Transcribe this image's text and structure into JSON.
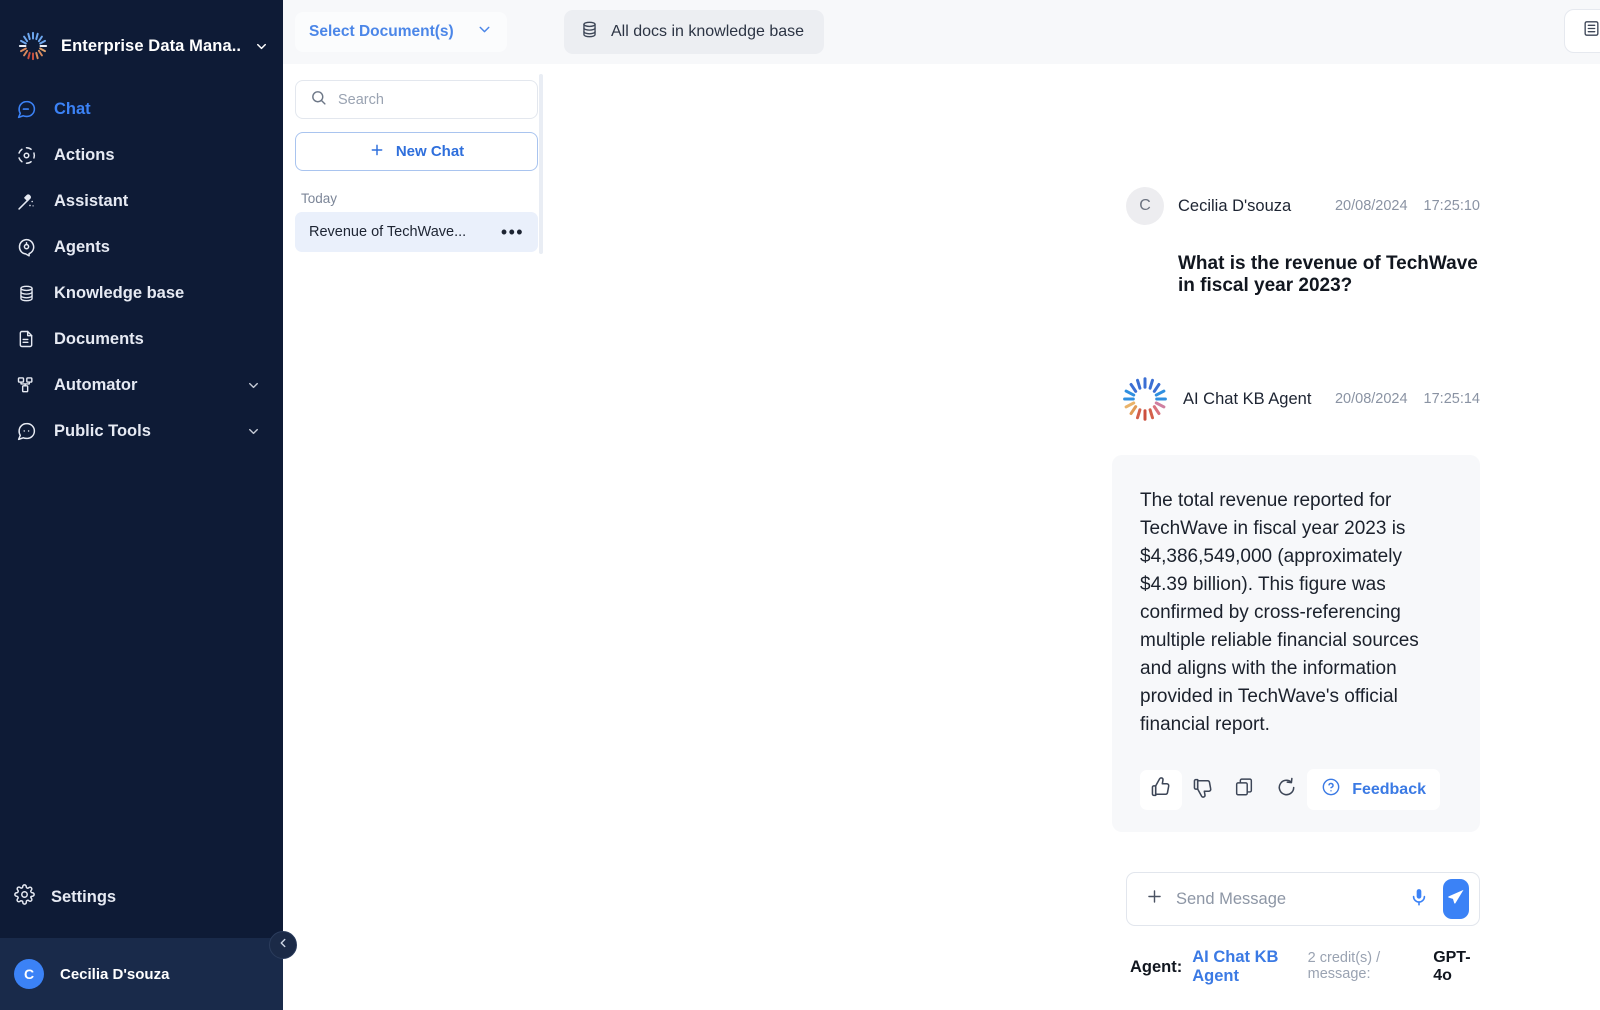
{
  "sidebar": {
    "brand": {
      "name": "Enterprise Data Mana..",
      "logo_icon": "sunburst-logo-icon",
      "caret_icon": "chevron-down-icon"
    },
    "items": [
      {
        "label": "Chat",
        "icon": "chat-bubble-icon",
        "active": true,
        "expandable": false
      },
      {
        "label": "Actions",
        "icon": "actions-gear-icon",
        "active": false,
        "expandable": false
      },
      {
        "label": "Assistant",
        "icon": "magic-wand-icon",
        "active": false,
        "expandable": false
      },
      {
        "label": "Agents",
        "icon": "agent-head-icon",
        "active": false,
        "expandable": false
      },
      {
        "label": "Knowledge base",
        "icon": "database-icon",
        "active": false,
        "expandable": false
      },
      {
        "label": "Documents",
        "icon": "document-icon",
        "active": false,
        "expandable": false
      },
      {
        "label": "Automator",
        "icon": "automator-nodes-icon",
        "active": false,
        "expandable": true
      },
      {
        "label": "Public Tools",
        "icon": "public-tools-chat-icon",
        "active": false,
        "expandable": true
      }
    ],
    "settings": {
      "label": "Settings",
      "icon": "gear-icon"
    },
    "user": {
      "name": "Cecilia D'souza",
      "initial": "C"
    },
    "collapse": {
      "icon": "chevron-left-icon"
    }
  },
  "chatlist": {
    "select_documents": {
      "label": "Select Document(s)",
      "caret_icon": "chevron-down-icon"
    },
    "search": {
      "placeholder": "Search",
      "value": "",
      "icon": "search-icon"
    },
    "new_chat": {
      "label": "New Chat",
      "icon": "plus-icon"
    },
    "group_label": "Today",
    "items": [
      {
        "title": "Revenue of TechWave...",
        "selected": true,
        "menu_icon": "ellipsis-icon"
      }
    ]
  },
  "header": {
    "knowledge_pill": {
      "label": "All docs in knowledge base",
      "icon": "database-icon"
    },
    "right_button": {
      "icon": "knowledge-list-icon"
    }
  },
  "conversation": {
    "user_message": {
      "author": "Cecilia D'souza",
      "initial": "C",
      "date": "20/08/2024",
      "time": "17:25:10",
      "text": "What is the revenue of TechWave in fiscal year 2023?"
    },
    "agent_message": {
      "author": "AI Chat KB Agent",
      "logo_icon": "sunburst-logo-icon",
      "date": "20/08/2024",
      "time": "17:25:14",
      "text": "The total revenue reported for TechWave in fiscal year 2023 is $4,386,549,000 (approximately $4.39 billion). This figure was confirmed by cross-referencing multiple reliable financial sources and aligns with the information provided in TechWave's official financial report.",
      "actions": [
        {
          "name": "thumbs-up",
          "icon": "thumbs-up-icon",
          "selected": true
        },
        {
          "name": "thumbs-down",
          "icon": "thumbs-down-icon",
          "selected": false
        },
        {
          "name": "copy",
          "icon": "copy-icon",
          "selected": false
        },
        {
          "name": "regenerate",
          "icon": "refresh-icon",
          "selected": false
        }
      ],
      "feedback": {
        "label": "Feedback",
        "icon": "question-circle-icon"
      }
    }
  },
  "composer": {
    "placeholder": "Send Message",
    "value": "",
    "attach_icon": "plus-icon",
    "mic_icon": "microphone-icon",
    "send_icon": "send-paper-plane-icon"
  },
  "footer": {
    "agent_label": "Agent:",
    "agent_name": "AI Chat KB Agent",
    "credits": "2 credit(s) / message:",
    "model": "GPT-4o"
  },
  "colors": {
    "sidebar_bg": "#0e1b36",
    "accent_blue": "#3b82f6",
    "link_blue": "#3b7ae4",
    "bubble_bg": "#f7f8fa",
    "selected_chat_bg": "#eaf0fb"
  }
}
